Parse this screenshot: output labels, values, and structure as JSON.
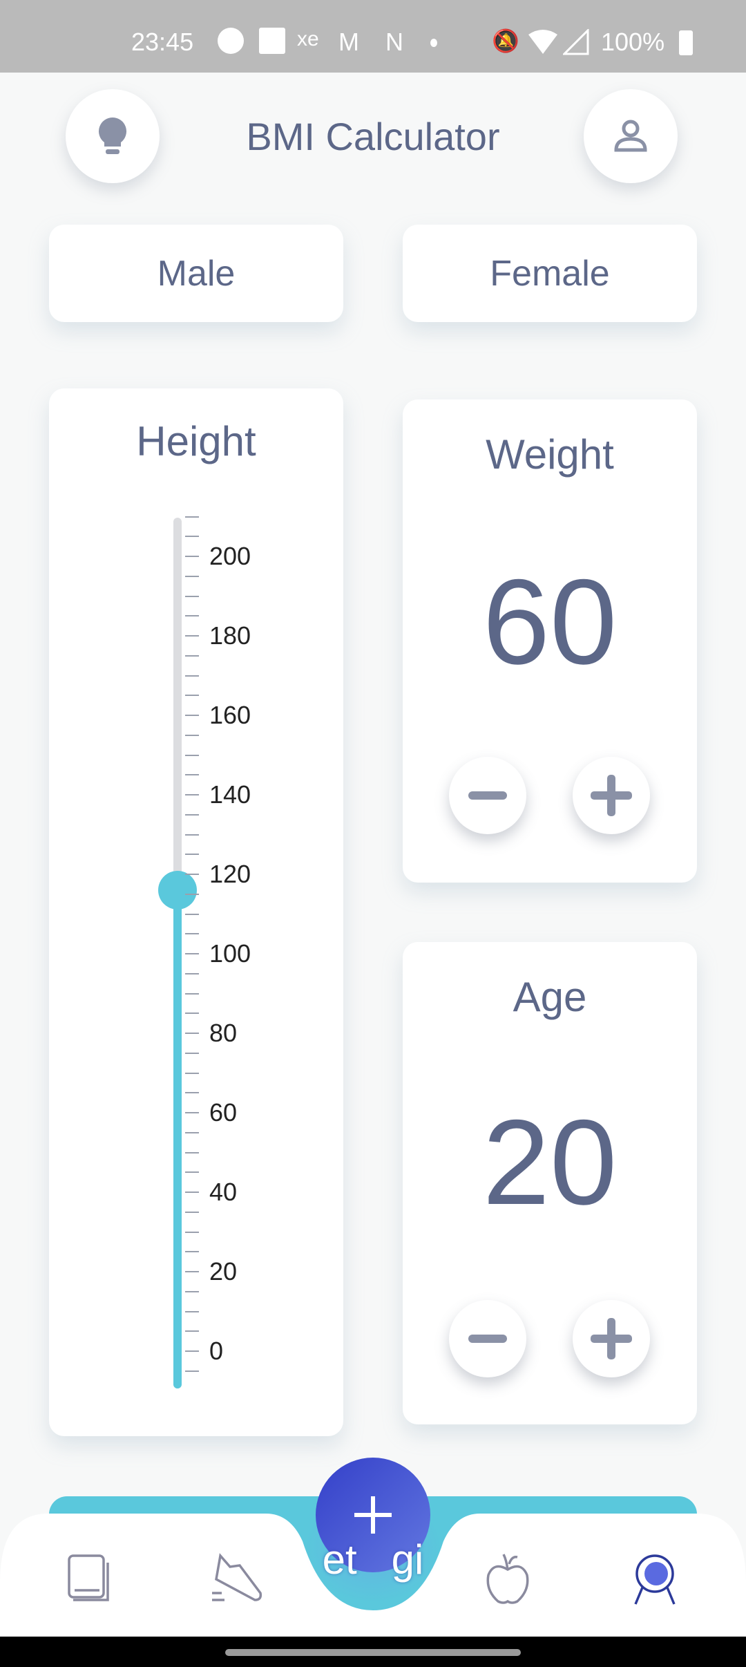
{
  "status_bar": {
    "time": "23:45",
    "battery": "100%",
    "icons": [
      "app-icon",
      "linkedin-icon",
      "xe-icon",
      "gmail-icon",
      "netflix-icon",
      "dot-icon",
      "bell-off-icon",
      "wifi-icon",
      "signal-icon",
      "battery-charging-icon"
    ]
  },
  "header": {
    "title": "BMI Calculator",
    "left_icon": "lightbulb-icon",
    "right_icon": "profile-icon"
  },
  "gender": {
    "male": "Male",
    "female": "Female"
  },
  "height": {
    "title": "Height",
    "value": 116,
    "min": -10,
    "max": 210,
    "labels": [
      "200",
      "180",
      "160",
      "140",
      "120",
      "100",
      "80",
      "60",
      "40",
      "20",
      "0"
    ]
  },
  "weight": {
    "title": "Weight",
    "value": "60"
  },
  "age": {
    "title": "Age",
    "value": "20"
  },
  "action": {
    "label": "et   gi"
  },
  "nav": {
    "items": [
      "book-icon",
      "shoe-icon",
      "add-icon",
      "apple-icon",
      "bmi-icon"
    ],
    "active": 4
  },
  "colors": {
    "accent": "#5ac8dc",
    "fab_start": "#3440c9",
    "fab_end": "#6277e0",
    "text": "#5c6788",
    "active_nav": "#2c3a9a"
  }
}
